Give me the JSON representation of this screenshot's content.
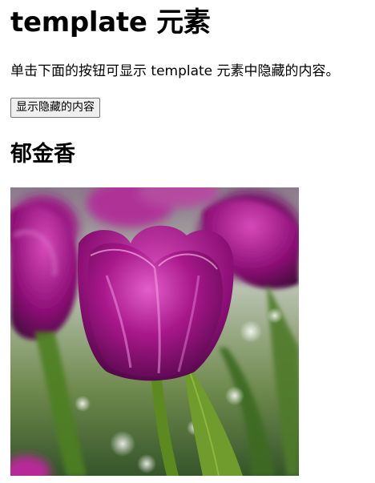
{
  "page": {
    "title": "template 元素",
    "description": "单击下面的按钮可显示 template 元素中隐藏的内容。",
    "button_label": "显示隐藏的内容",
    "section_heading": "郁金香"
  },
  "image": {
    "subject": "tulip-photo",
    "colors": {
      "petal": "#a0177f",
      "petal_dark": "#5a0850",
      "petal_light": "#e15fc8",
      "leaf": "#5f8f2a",
      "background": "#c9d3c3"
    }
  }
}
